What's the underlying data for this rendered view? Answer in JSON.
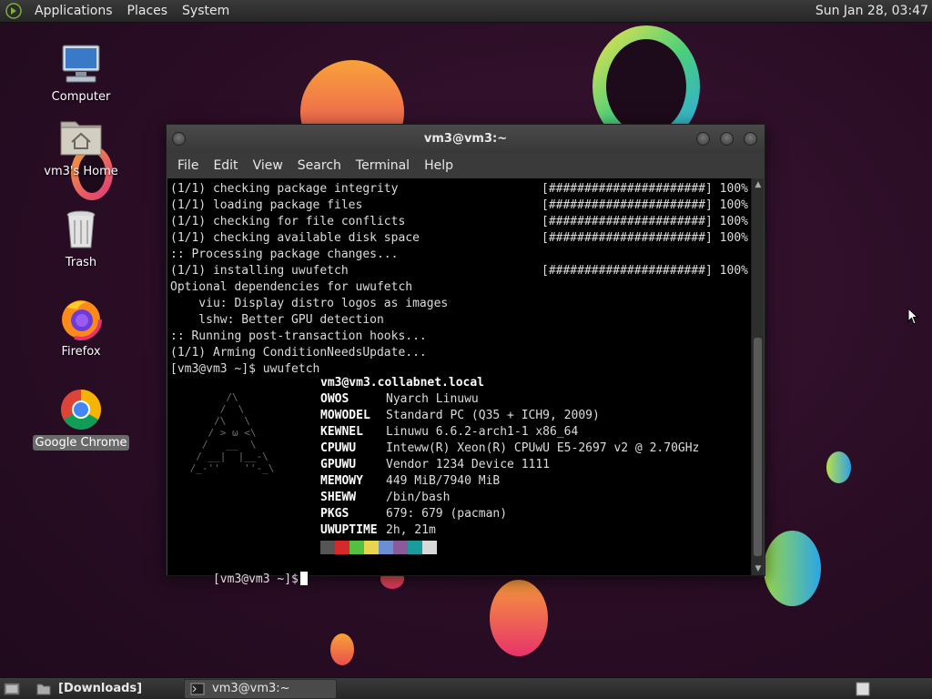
{
  "top_panel": {
    "menus": [
      "Applications",
      "Places",
      "System"
    ],
    "clock": "Sun Jan 28, 03:47"
  },
  "desktop": {
    "icons": [
      {
        "label": "Computer",
        "icon": "computer-icon"
      },
      {
        "label": "vm3's Home",
        "icon": "home-folder-icon"
      },
      {
        "label": "Trash",
        "icon": "trash-icon"
      },
      {
        "label": "Firefox",
        "icon": "firefox-icon"
      },
      {
        "label": "Google Chrome",
        "icon": "chrome-icon",
        "selected": true
      }
    ]
  },
  "window": {
    "title": "vm3@vm3:~",
    "menus": [
      "File",
      "Edit",
      "View",
      "Search",
      "Terminal",
      "Help"
    ]
  },
  "terminal": {
    "lines": [
      {
        "text": "(1/1) checking package integrity",
        "right": "[######################] 100%"
      },
      {
        "text": "(1/1) loading package files",
        "right": "[######################] 100%"
      },
      {
        "text": "(1/1) checking for file conflicts",
        "right": "[######################] 100%"
      },
      {
        "text": "(1/1) checking available disk space",
        "right": "[######################] 100%"
      },
      {
        "text": ":: Processing package changes...",
        "right": ""
      },
      {
        "text": "(1/1) installing uwufetch",
        "right": "[######################] 100%"
      },
      {
        "text": "Optional dependencies for uwufetch",
        "right": ""
      },
      {
        "text": "    viu: Display distro logos as images",
        "right": ""
      },
      {
        "text": "    lshw: Better GPU detection",
        "right": ""
      },
      {
        "text": ":: Running post-transaction hooks...",
        "right": ""
      },
      {
        "text": "(1/1) Arming ConditionNeedsUpdate...",
        "right": ""
      },
      {
        "text": "[vm3@vm3 ~]$ uwufetch",
        "right": ""
      }
    ],
    "fetch": {
      "host": "vm3@vm3.collabnet.local",
      "rows": [
        {
          "key": "OWOS",
          "value": "Nyarch Linuwu"
        },
        {
          "key": "MOWODEL",
          "value": "Standard PC (Q35 + ICH9, 2009)"
        },
        {
          "key": "KEWNEL",
          "value": "Linuwu 6.6.2-arch1-1 x86_64"
        },
        {
          "key": "CPUWU",
          "value": "Inteww(R) Xeon(R) CPUwU E5-2697 v2 @ 2.70GHz"
        },
        {
          "key": "GPUWU",
          "value": "Vendor 1234 Device 1111"
        },
        {
          "key": "MEMOWY",
          "value": "449 MiB/7940 MiB"
        },
        {
          "key": "SHEWW",
          "value": "/bin/bash"
        },
        {
          "key": "PKGS",
          "value": "679: 679 (pacman)"
        },
        {
          "key": "UWUPTIME",
          "value": "2h, 21m"
        }
      ],
      "palette": [
        "#555555",
        "#d62a2a",
        "#52c043",
        "#e8d44d",
        "#6c8fd3",
        "#8a5a9a",
        "#1a9c9c",
        "#d8d8d8"
      ]
    },
    "prompt": "[vm3@vm3 ~]$"
  },
  "bottom_panel": {
    "tasks": [
      {
        "label": "[Downloads]",
        "icon": "folder-icon"
      },
      {
        "label": "vm3@vm3:~",
        "icon": "terminal-icon",
        "active": true
      }
    ]
  }
}
